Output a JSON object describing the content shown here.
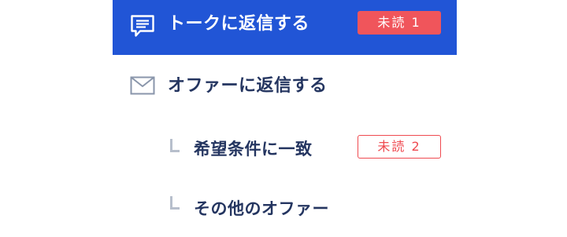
{
  "menu": {
    "talk_reply": {
      "label": "トークに返信する",
      "badge": "未読 1",
      "icon": "chat-icon"
    },
    "offer_reply": {
      "label": "オファーに返信する",
      "icon": "mail-icon"
    },
    "offer_match": {
      "label": "希望条件に一致",
      "badge": "未読 2"
    },
    "offer_other": {
      "label": "その他のオファー"
    }
  },
  "colors": {
    "active_background": "#2155d6",
    "text": "#243560",
    "badge_red": "#ef4a50",
    "branch_line": "#b7bfcc"
  }
}
